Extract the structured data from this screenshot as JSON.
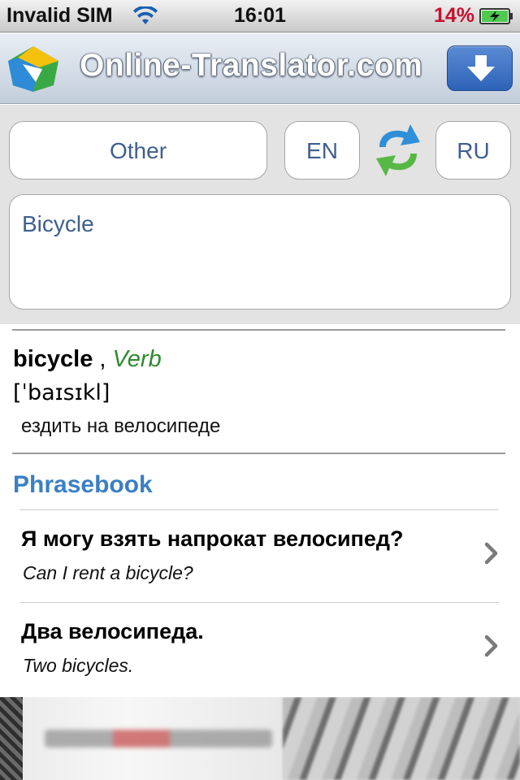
{
  "status_bar": {
    "carrier": "Invalid SIM",
    "time": "16:01",
    "battery_percent": "14%",
    "battery_level": 0.14,
    "battery_charging": true
  },
  "app_bar": {
    "title": "Online-Translator.com",
    "download_icon": "download-arrow-icon",
    "logo_icon": "translator-logo-icon"
  },
  "controls": {
    "topic": "Other",
    "source_lang": "EN",
    "target_lang": "RU",
    "swap_icon": "swap-arrows-icon",
    "input_text": "Bicycle"
  },
  "result": {
    "headword": "bicycle",
    "separator": ",",
    "part_of_speech": "Verb",
    "transcription": "[ˈbaɪsɪkl]",
    "translation": "ездить на велосипеде"
  },
  "phrasebook": {
    "title": "Phrasebook",
    "items": [
      {
        "ru": "Я могу взять напрокат велосипед?",
        "en": "Can I rent a bicycle?"
      },
      {
        "ru": "Два велосипеда.",
        "en": "Two bicycles."
      }
    ]
  },
  "colors": {
    "accent_blue": "#3b7fc4",
    "pos_green": "#2f8a2f",
    "battery_red": "#c8102e",
    "button_blue": "#2d63b8"
  }
}
